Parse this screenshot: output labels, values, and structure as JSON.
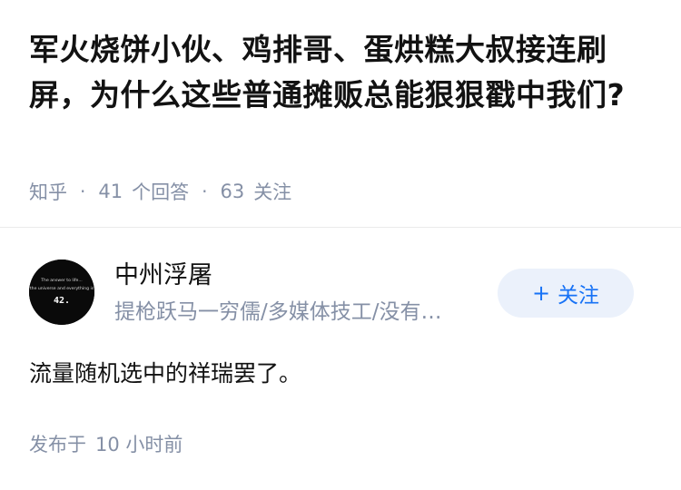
{
  "question": {
    "title": "军火烧饼小伙、鸡排哥、蛋烘糕大叔接连刷屏，为什么这些普通摊贩总能狠狠戳中我们?",
    "source": "知乎",
    "answers_count": "41",
    "answers_label": "个回答",
    "follows_count": "63",
    "follows_label": "关注"
  },
  "author": {
    "avatar_text_line1": "The answer to life...",
    "avatar_text_line2": "the universe and everything is",
    "avatar_number": "42.",
    "name": "中州浮屠",
    "bio": "提枪跃马一穷儒/多媒体技工/没有…",
    "follow_plus": "+",
    "follow_label": "关注"
  },
  "answer": {
    "content": "流量随机选中的祥瑞罢了。",
    "posted_prefix": "发布于",
    "posted_time": "10 小时前"
  },
  "colors": {
    "primary": "#1772f6",
    "follow_bg": "#ebf1fb",
    "muted": "#8590a6",
    "text": "#121212"
  }
}
